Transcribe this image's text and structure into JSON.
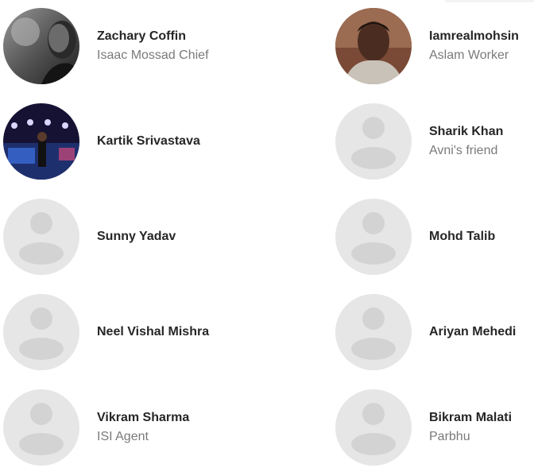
{
  "contacts": [
    {
      "name": "Zachary Coffin",
      "subtitle": "Isaac Mossad Chief",
      "avatar": "photo-bw"
    },
    {
      "name": "Iamrealmohsin",
      "subtitle": "Aslam Worker",
      "avatar": "photo-portrait"
    },
    {
      "name": "Kartik Srivastava",
      "subtitle": "",
      "avatar": "photo-stage"
    },
    {
      "name": "Sharik Khan",
      "subtitle": "Avni's friend",
      "avatar": "default-person-icon"
    },
    {
      "name": "Sunny Yadav",
      "subtitle": "",
      "avatar": "default-person-icon"
    },
    {
      "name": "Mohd Talib",
      "subtitle": "",
      "avatar": "default-person-icon"
    },
    {
      "name": "Neel Vishal Mishra",
      "subtitle": "",
      "avatar": "default-person-icon"
    },
    {
      "name": "Ariyan Mehedi",
      "subtitle": "",
      "avatar": "default-person-icon"
    },
    {
      "name": "Vikram Sharma",
      "subtitle": "ISI Agent",
      "avatar": "default-person-icon"
    },
    {
      "name": "Bikram Malati",
      "subtitle": "Parbhu",
      "avatar": "default-person-icon"
    }
  ],
  "colors": {
    "placeholder_bg": "#e6e6e6",
    "placeholder_fg": "#d3d3d3",
    "name": "#262626",
    "subtitle": "#7a7a7a"
  }
}
